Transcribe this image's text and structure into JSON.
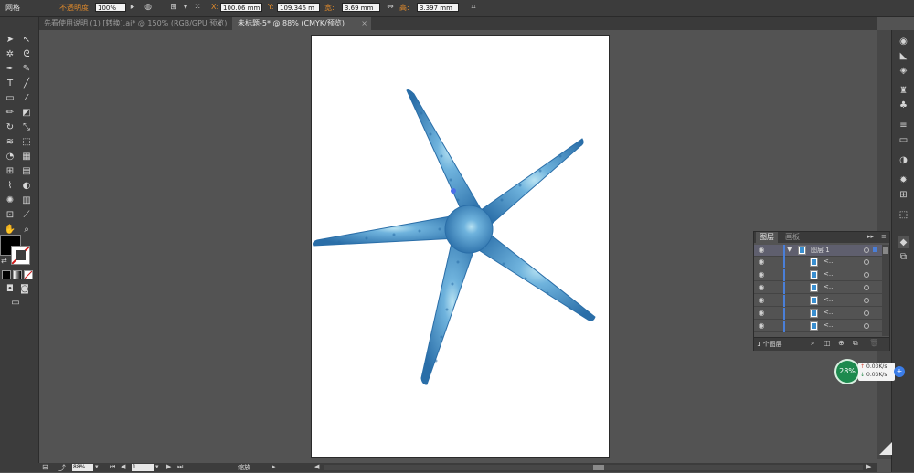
{
  "control_bar": {
    "mode_label": "网格",
    "opacity_label": "不透明度",
    "opacity_value": "100%",
    "x_label": "X:",
    "x_value": "100.06 mm",
    "y_label": "Y:",
    "y_value": "109.346 m",
    "width_label": "宽:",
    "width_value": "3.69 mm",
    "height_label": "高:",
    "height_value": "3.397 mm"
  },
  "tabs": [
    {
      "label": "先看使用说明 (1) [转换].ai* @ 150% (RGB/GPU 预览)",
      "active": false
    },
    {
      "label": "未标题-5* @ 88% (CMYK/预览)",
      "active": true
    }
  ],
  "layers_panel": {
    "tab_layers": "图层",
    "tab_artboards": "画板",
    "layer_name": "图层 1",
    "sublayer_label": "<...",
    "sublayer_count": 6,
    "footer_count": "1 个图层",
    "accent_color": "#4a7fd8"
  },
  "status_bar": {
    "zoom": "88%",
    "page": "1",
    "tool_name": "缩放"
  },
  "net_widget": {
    "percent": "28%",
    "upload": "0.03K/s",
    "download": "0.03K/s"
  },
  "colors": {
    "starfish_main": "#3d8dcc",
    "starfish_dark": "#2a6ea8",
    "starfish_light": "#9fd0ea"
  }
}
